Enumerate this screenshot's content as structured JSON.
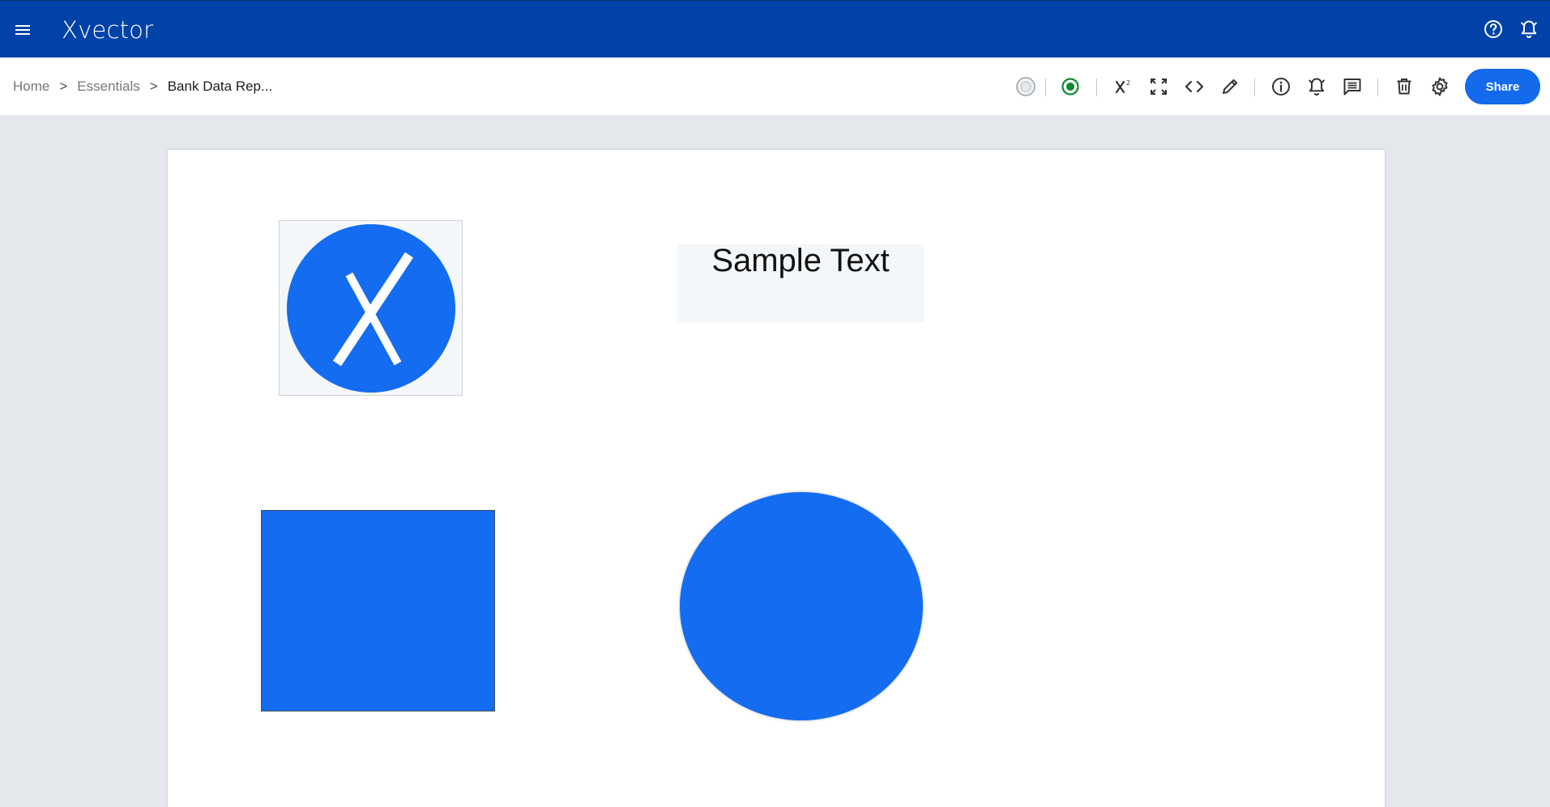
{
  "app": {
    "brand": "Xvector",
    "brand_color": "#0042a8",
    "accent_color": "#136aeb"
  },
  "topbar": {
    "menu_icon": "hamburger-menu-icon",
    "right_icons": [
      "help-icon",
      "notifications-icon"
    ]
  },
  "breadcrumb": {
    "items": [
      "Home",
      "Essentials",
      "Bank Data Rep..."
    ],
    "separator": ">"
  },
  "toolbar": {
    "icons": [
      "status-light-icon",
      "live-status-icon",
      "superscript-x-icon",
      "fullscreen-icon",
      "code-icon",
      "edit-pencil-icon",
      "info-icon",
      "alert-bell-icon",
      "comment-icon",
      "delete-icon",
      "settings-icon"
    ],
    "share_label": "Share"
  },
  "canvas": {
    "text_widget": "Sample Text",
    "shape_fill": "#146cf0"
  }
}
